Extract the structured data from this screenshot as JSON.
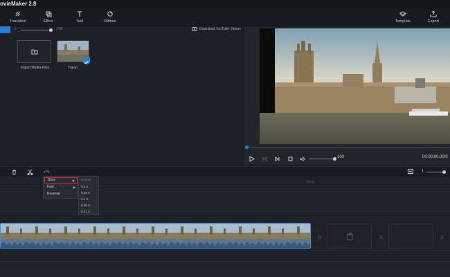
{
  "app": {
    "title": "ovieMaker 2.8"
  },
  "toolbar": {
    "transition": "Transition",
    "effect": "Effect",
    "text": "Text",
    "ribbon": "Ribbon",
    "template": "Template",
    "export": "Export"
  },
  "media": {
    "zoom_min_label": "1",
    "zoom_max_label": "100",
    "download_label": "Download YouTube Videos",
    "import_label": "Import Media Files",
    "clip_label": "Travel"
  },
  "player": {
    "volume": "100",
    "timecode": "00:00:00.00/0",
    "progress": 0.0
  },
  "timeline": {
    "zoom_label": "1",
    "ruler_label": "00:45"
  },
  "speed_menu": {
    "items": [
      {
        "label": "Slow",
        "has_submenu": true,
        "selected": true
      },
      {
        "label": "Fast",
        "has_submenu": true,
        "selected": false
      },
      {
        "label": "Reverse",
        "has_submenu": false,
        "selected": false
      }
    ],
    "arrow": "▶",
    "submenu": {
      "header": "Normal",
      "options": [
        "0.5 X",
        "0.25 X",
        "0.1 X",
        "0.05 X",
        "0.01 X"
      ]
    }
  },
  "colors": {
    "accent": "#2e7bd6",
    "highlight_border": "#d9302c",
    "background": "#1c1d22"
  }
}
